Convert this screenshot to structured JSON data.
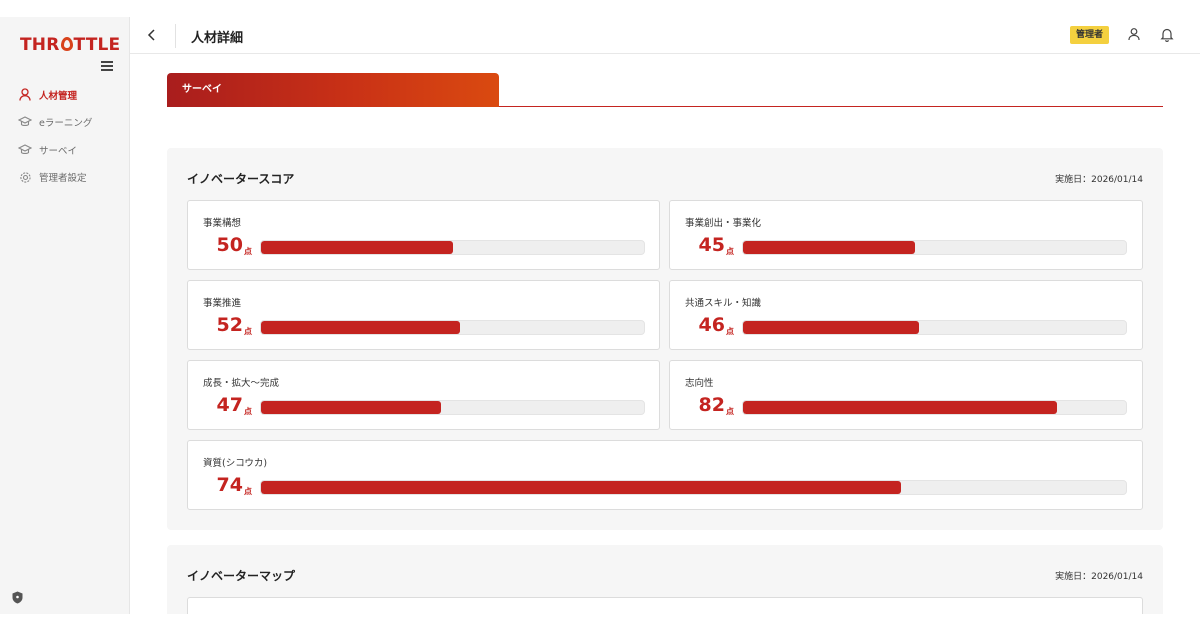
{
  "app": {
    "logo_text_left": "THR",
    "logo_text_right": "TTLE"
  },
  "sidebar": {
    "items": [
      {
        "label": "人材管理",
        "icon": "person-icon",
        "active": true
      },
      {
        "label": "eラーニング",
        "icon": "mortarboard-icon",
        "active": false
      },
      {
        "label": "サーベイ",
        "icon": "mortarboard-icon",
        "active": false
      },
      {
        "label": "管理者設定",
        "icon": "gear-icon",
        "active": false
      }
    ]
  },
  "header": {
    "title": "人材詳細",
    "role_badge": "管理者"
  },
  "tabs": [
    {
      "label": "サーベイ",
      "active": true
    }
  ],
  "innovator_score": {
    "title": "イノベータースコア",
    "date": "実施日：2026/01/14",
    "unit": "点",
    "items": [
      {
        "label": "事業構想",
        "value": 50,
        "ratio": 0.5
      },
      {
        "label": "事業創出・事業化",
        "value": 45,
        "ratio": 0.45
      },
      {
        "label": "事業推進",
        "value": 52,
        "ratio": 0.52
      },
      {
        "label": "共通スキル・知識",
        "value": 46,
        "ratio": 0.46
      },
      {
        "label": "成長・拡大〜完成",
        "value": 47,
        "ratio": 0.47
      },
      {
        "label": "志向性",
        "value": 82,
        "ratio": 0.82
      },
      {
        "label": "資質(シコウカ)",
        "value": 74,
        "ratio": 0.74
      }
    ]
  },
  "innovator_map": {
    "title": "イノベーターマップ",
    "date": "実施日：2026/01/14"
  },
  "colors": {
    "accent": "#c42420",
    "badge": "#f4d03f",
    "tab_gradient_end": "#da4a10"
  }
}
